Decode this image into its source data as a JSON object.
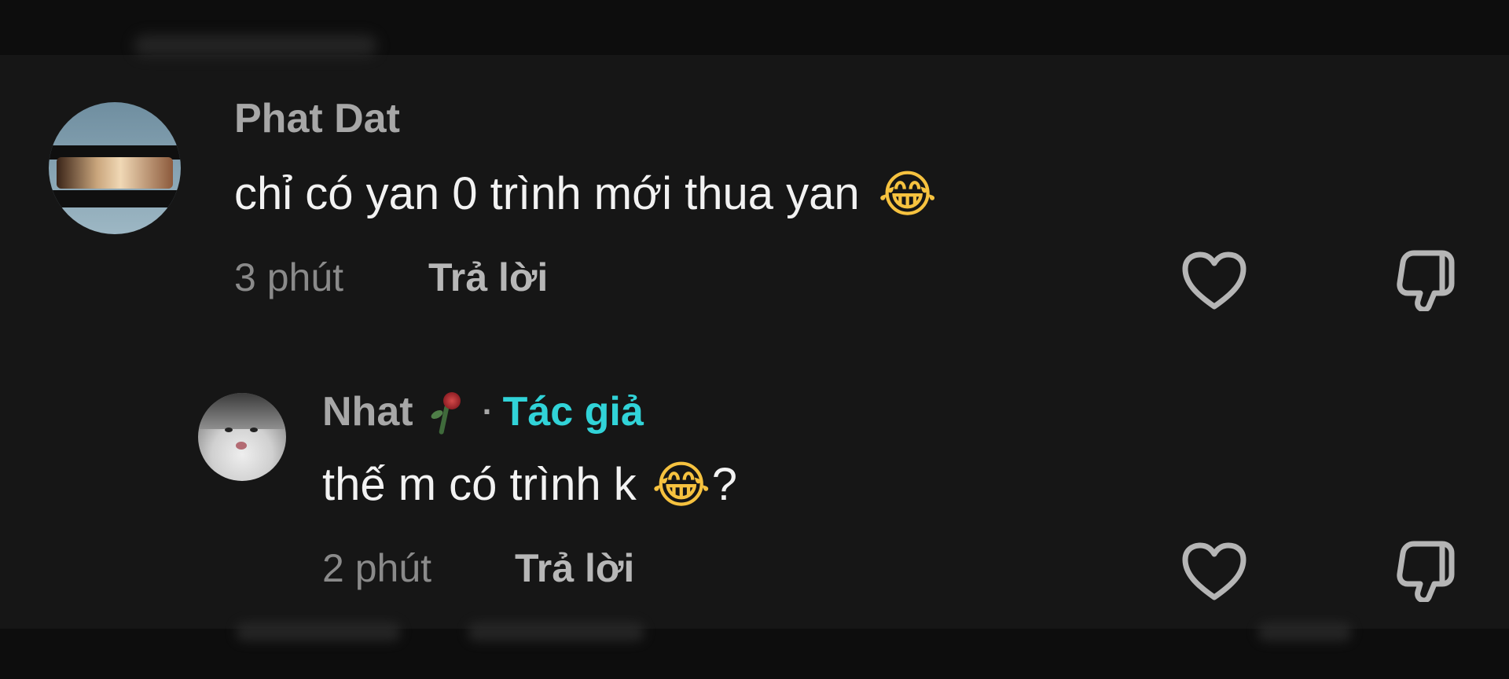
{
  "comments": [
    {
      "username": "Phat Dat",
      "text": "chỉ có yan 0 trình mới thua yan",
      "emoji": "😂",
      "time": "3 phút",
      "reply_label": "Trả lời",
      "avatar_icon": "toy-car-icon",
      "actions": {
        "like_icon": "heart-icon",
        "dislike_icon": "thumbs-down-icon"
      }
    },
    {
      "username": "Nhat",
      "badge_icon": "wilted-rose-icon",
      "separator": "·",
      "author_tag": "Tác giả",
      "text": "thế m có trình k",
      "emoji": "😂",
      "suffix": "?",
      "time": "2 phút",
      "reply_label": "Trả lời",
      "avatar_icon": "cat-avatar-icon",
      "actions": {
        "like_icon": "heart-icon",
        "dislike_icon": "thumbs-down-icon"
      }
    }
  ],
  "colors": {
    "background": "#161616",
    "username": "#a7a7a7",
    "text": "#f2f2f2",
    "meta": "#8a8a8a",
    "reply": "#b7b7b7",
    "author_tag": "#31d3d8"
  }
}
